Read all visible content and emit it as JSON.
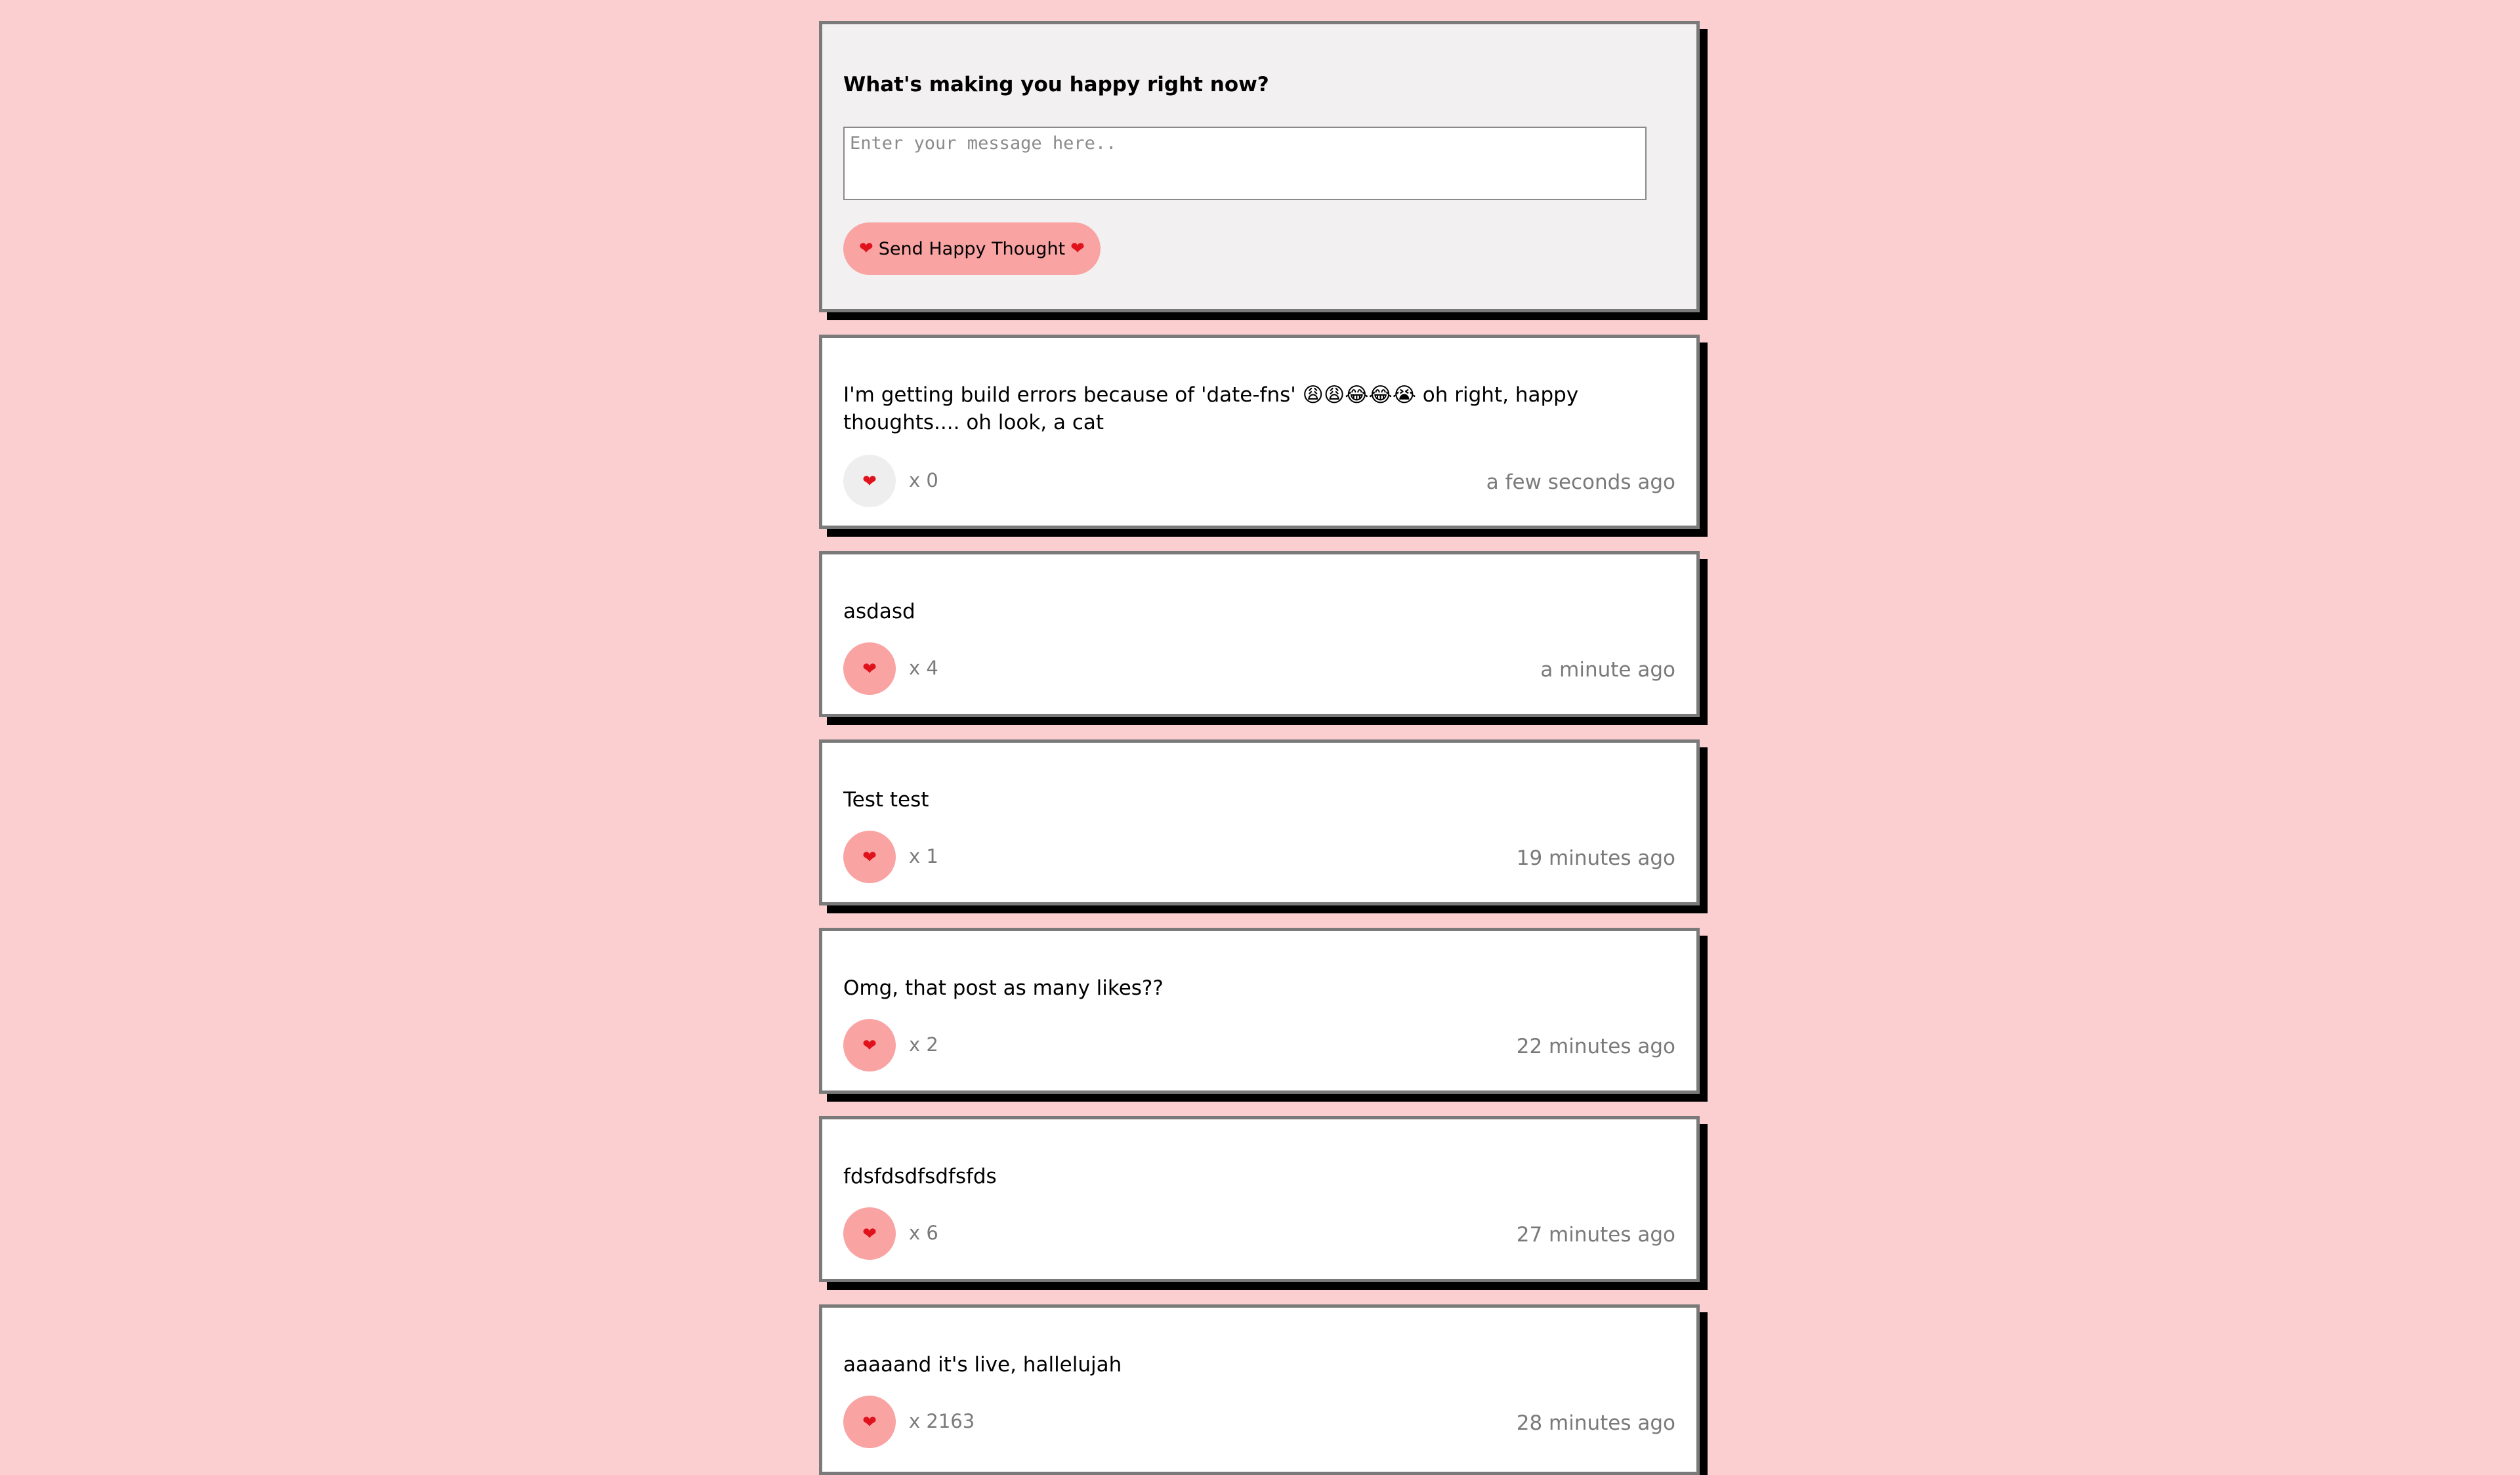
{
  "composer": {
    "prompt": "What's making you happy right now?",
    "placeholder": "Enter your message here..",
    "value": "",
    "send_label": "Send Happy Thought",
    "heart_glyph": "❤"
  },
  "thoughts": [
    {
      "message": "I'm getting build errors because of 'date-fns' 😩😩😂😂😭 oh right, happy thoughts.... oh look, a cat",
      "likes_text": "x 0",
      "time": "a few seconds ago"
    },
    {
      "message": "asdasd",
      "likes_text": "x 4",
      "time": "a minute ago"
    },
    {
      "message": "Test test",
      "likes_text": "x 1",
      "time": "19 minutes ago"
    },
    {
      "message": "Omg, that post as many likes??",
      "likes_text": "x 2",
      "time": "22 minutes ago"
    },
    {
      "message": "fdsfdsdfsdfsfds",
      "likes_text": "x 6",
      "time": "27 minutes ago"
    },
    {
      "message": "aaaaand it's live, hallelujah",
      "likes_text": "x 2163",
      "time": "28 minutes ago"
    }
  ],
  "colors": {
    "page_background": "#fbcfcf",
    "button_pink": "#f9a3a3",
    "heart_red": "#e0121c",
    "muted_text": "#7a7a7a"
  }
}
